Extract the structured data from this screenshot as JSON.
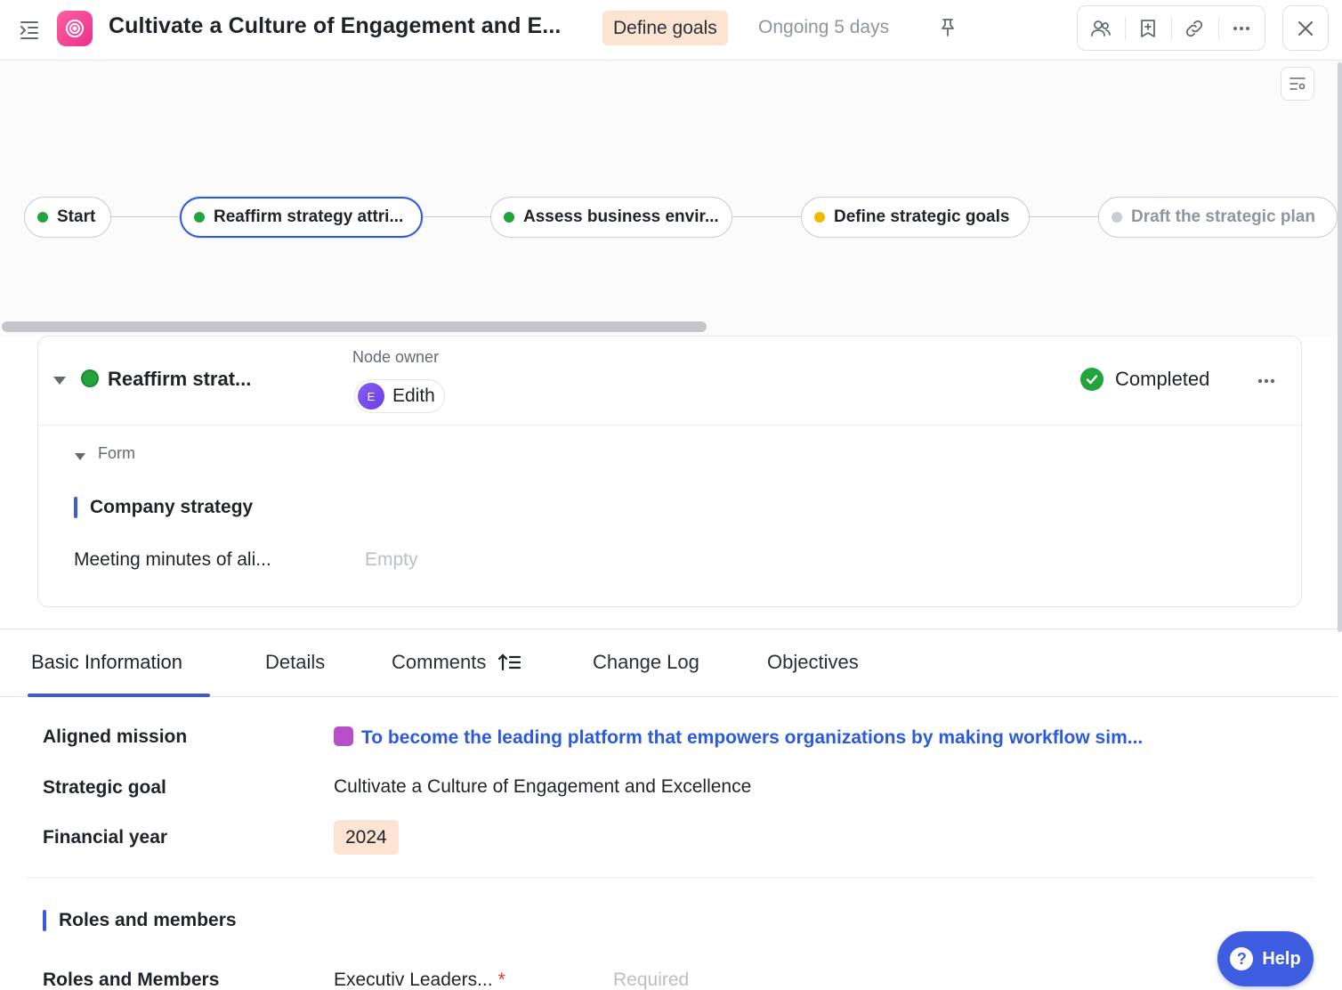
{
  "header": {
    "title": "Cultivate a Culture of Engagement and E...",
    "stage": "Define goals",
    "status": "Ongoing 5 days"
  },
  "flow": {
    "nodes": [
      {
        "label": "Start",
        "state": "done"
      },
      {
        "label": "Reaffirm strategy attri...",
        "state": "done",
        "active": true
      },
      {
        "label": "Assess business envir...",
        "state": "done"
      },
      {
        "label": "Define strategic goals",
        "state": "in-progress"
      },
      {
        "label": "Draft the strategic plan",
        "state": "pending"
      }
    ]
  },
  "node_card": {
    "title": "Reaffirm strat...",
    "owner_label": "Node owner",
    "owner_initial": "E",
    "owner_name": "Edith",
    "status": "Completed",
    "form_label": "Form",
    "section_title": "Company strategy",
    "field_label": "Meeting minutes of ali...",
    "field_value": "Empty"
  },
  "tabs": [
    {
      "label": "Basic Information"
    },
    {
      "label": "Details"
    },
    {
      "label": "Comments"
    },
    {
      "label": "Change Log"
    },
    {
      "label": "Objectives"
    }
  ],
  "basic_info": {
    "aligned_mission_label": "Aligned mission",
    "aligned_mission_value": "To become the leading platform that empowers organizations by making workflow sim...",
    "strategic_goal_label": "Strategic goal",
    "strategic_goal_value": "Cultivate a Culture of Engagement and Excellence",
    "financial_year_label": "Financial year",
    "financial_year_value": "2024",
    "roles_section_title": "Roles and members",
    "roles_label": "Roles and Members",
    "roles_value": "Executiv Leaders...",
    "required_star": "*",
    "required_placeholder": "Required"
  },
  "help": {
    "label": "Help",
    "glyph": "?"
  },
  "colors": {
    "accent": "#3b5bdb",
    "done": "#22a33b",
    "in_progress": "#f5b800",
    "pending": "#c9cdd4",
    "stage_chip": "#fde3d1",
    "mission_square": "#b74fc9"
  }
}
